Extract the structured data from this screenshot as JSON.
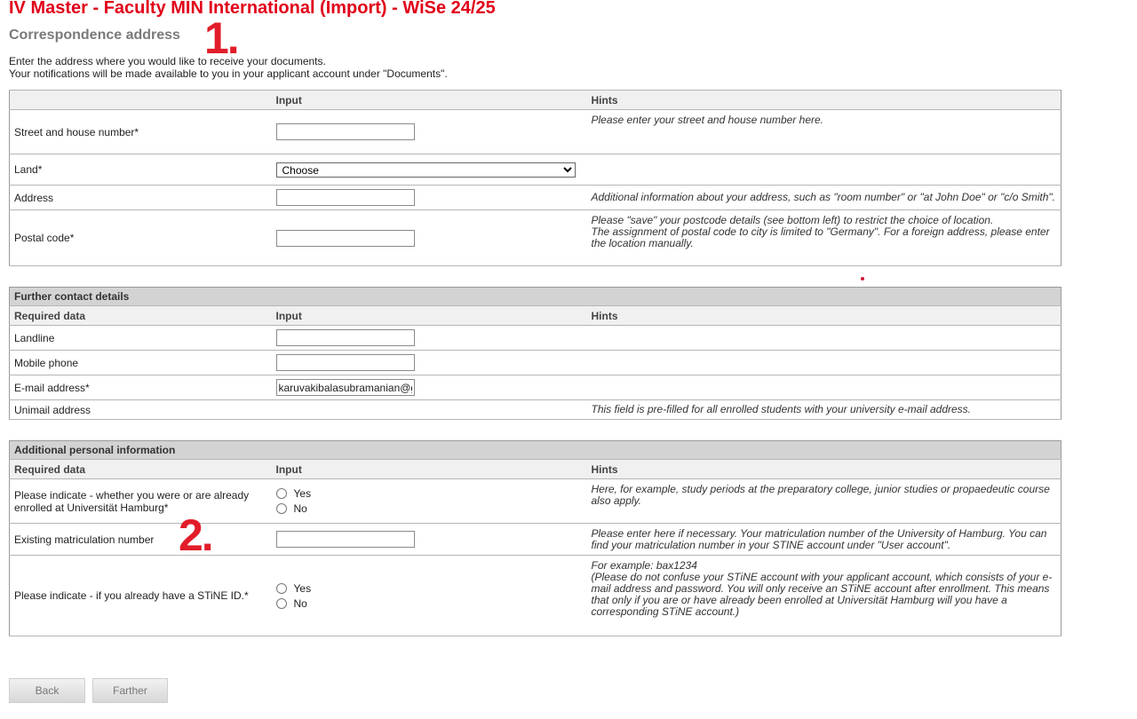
{
  "header": {
    "title": "IV Master - Faculty MIN International (Import) - WiSe 24/25",
    "subtitle": "Correspondence address",
    "intro_line1": "Enter the address where you would like to receive your documents.",
    "intro_line2": "Your notifications will be made available to you in your applicant account under \"Documents\"."
  },
  "annotations": {
    "mark1": "1.",
    "mark2": "2."
  },
  "columns": {
    "required": "Required data",
    "input": "Input",
    "hints": "Hints"
  },
  "address": {
    "street": {
      "label": "Street and house number*",
      "value": "",
      "hint": "Please enter your street and house number here."
    },
    "land": {
      "label": "Land*",
      "selected": "Choose",
      "hint": ""
    },
    "address": {
      "label": "Address",
      "value": "",
      "hint": "Additional information about your address, such as \"room number\" or \"at John Doe\" or \"c/o Smith\"."
    },
    "postal": {
      "label": "Postal code*",
      "value": "",
      "hint_line1": "Please \"save\" your postcode details (see bottom left) to restrict the choice of location.",
      "hint_line2": "The assignment of postal code to city is limited to \"Germany\". For a foreign address, please enter the location manually."
    }
  },
  "contact": {
    "section_title": "Further contact details",
    "landline": {
      "label": "Landline",
      "value": ""
    },
    "mobile": {
      "label": "Mobile phone",
      "value": ""
    },
    "email": {
      "label": "E-mail address*",
      "value": "karuvakibalasubramanian@gmail.com"
    },
    "unimail": {
      "label": "Unimail address",
      "hint": "This field is pre-filled for all enrolled students with your university e-mail address."
    }
  },
  "personal": {
    "section_title": "Additional personal information",
    "enrolled": {
      "label_line1": "Please indicate - whether you were or are already",
      "label_line2": "enrolled at Universität Hamburg*",
      "options": [
        "Yes",
        "No"
      ],
      "hint": "Here, for example, study periods at the preparatory college, junior studies or propaedeutic course also apply."
    },
    "matriculation": {
      "label": "Existing matriculation number",
      "value": "",
      "hint": "Please enter here if necessary. Your matriculation number of the University of Hamburg. You can find your matriculation number in your STINE account under \"User account\"."
    },
    "stine": {
      "label": "Please indicate - if you already have a STiNE ID.*",
      "options": [
        "Yes",
        "No"
      ],
      "hint_line1": "For example: bax1234",
      "hint_line2": "(Please do not confuse your STiNE account with your applicant account, which consists of your e-mail address and password. You will only receive an STiNE account after enrollment. This means that only if you are or have already been enrolled at Universität Hamburg will you have a corresponding STiNE account.)"
    }
  },
  "buttons": {
    "back": "Back",
    "next": "Farther"
  }
}
